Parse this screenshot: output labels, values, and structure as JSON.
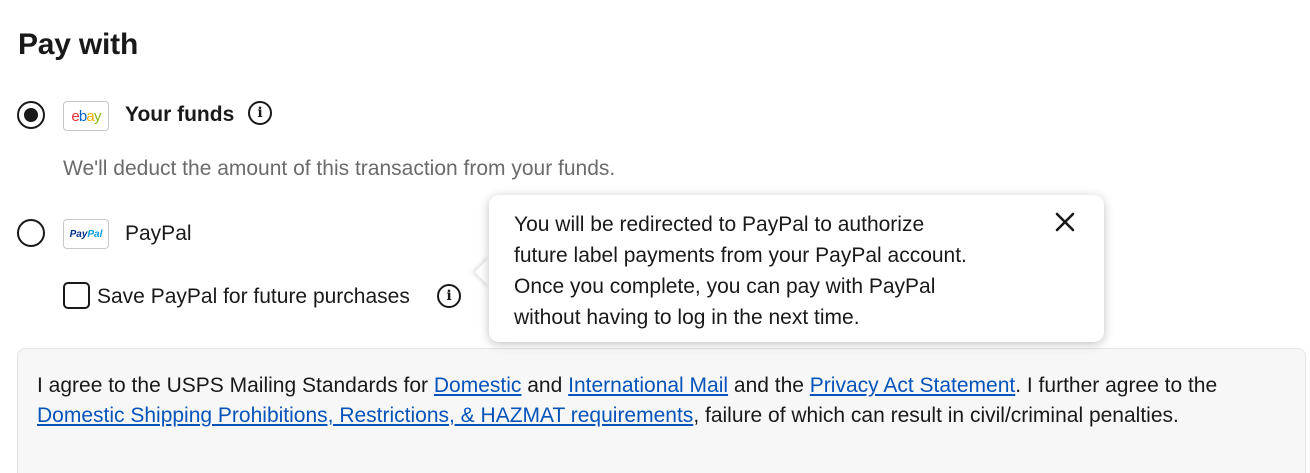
{
  "page": {
    "title": "Pay with"
  },
  "payment_options": {
    "funds": {
      "label": "Your funds",
      "selected": true,
      "logo_text": {
        "e": "e",
        "b": "b",
        "a": "a",
        "y": "y"
      },
      "helper_text": "We'll deduct the amount of this transaction from your funds."
    },
    "paypal": {
      "label": "PayPal",
      "selected": false,
      "logo_text": {
        "pay": "Pay",
        "pal": "Pal"
      },
      "save_checkbox_label": "Save PayPal for future purchases",
      "save_checked": false
    }
  },
  "tooltip": {
    "line1": "You will be redirected to PayPal to authorize",
    "line2": "future label payments from your PayPal account.",
    "line3": "Once you complete, you can pay with PayPal",
    "line4": "without having to log in the next time."
  },
  "legal": {
    "part1": "I agree to the USPS Mailing Standards for ",
    "link_domestic": "Domestic",
    "part2": " and ",
    "link_international": "International Mail",
    "part3": " and the ",
    "link_privacy": "Privacy Act Statement",
    "part4": ". I further agree to the ",
    "link_prohibitions": "Domestic Shipping Prohibitions, Restrictions, & HAZMAT requirements",
    "part5": ", failure of which can result in civil/criminal penalties."
  },
  "colors": {
    "text": "#191919",
    "muted": "#6b6b6b",
    "link": "#0654ba",
    "panel_bg": "#f7f7f7"
  },
  "icons": {
    "info": "info-circle-icon",
    "close": "close-icon"
  }
}
